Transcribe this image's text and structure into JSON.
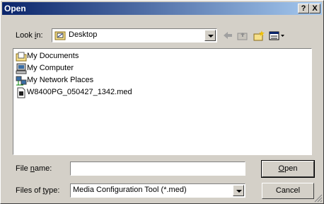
{
  "window": {
    "title": "Open",
    "help_btn": "?",
    "close_btn": "X"
  },
  "lookin": {
    "label_pre": "Look ",
    "label_u": "i",
    "label_post": "n:",
    "value": "Desktop",
    "icon": "desktop-folder-icon"
  },
  "toolbar": {
    "back": "back-arrow-icon",
    "up": "up-folder-icon",
    "newfolder": "new-folder-icon",
    "views": "views-menu-icon"
  },
  "files": [
    {
      "name": "My Documents",
      "icon": "my-documents-icon"
    },
    {
      "name": "My Computer",
      "icon": "my-computer-icon"
    },
    {
      "name": "My Network Places",
      "icon": "network-places-icon"
    },
    {
      "name": "W8400PG_050427_1342.med",
      "icon": "file-icon"
    }
  ],
  "filename": {
    "label_pre": "File ",
    "label_u": "n",
    "label_post": "ame:",
    "value": ""
  },
  "filetype": {
    "label_pre": "Files of ",
    "label_u": "t",
    "label_post": "ype:",
    "value": "Media Configuration Tool (*.med)"
  },
  "buttons": {
    "open_u": "O",
    "open_rest": "pen",
    "cancel": "Cancel"
  },
  "colors": {
    "title_start": "#0a246a",
    "title_end": "#a6caf0",
    "face": "#d4d0c8"
  }
}
